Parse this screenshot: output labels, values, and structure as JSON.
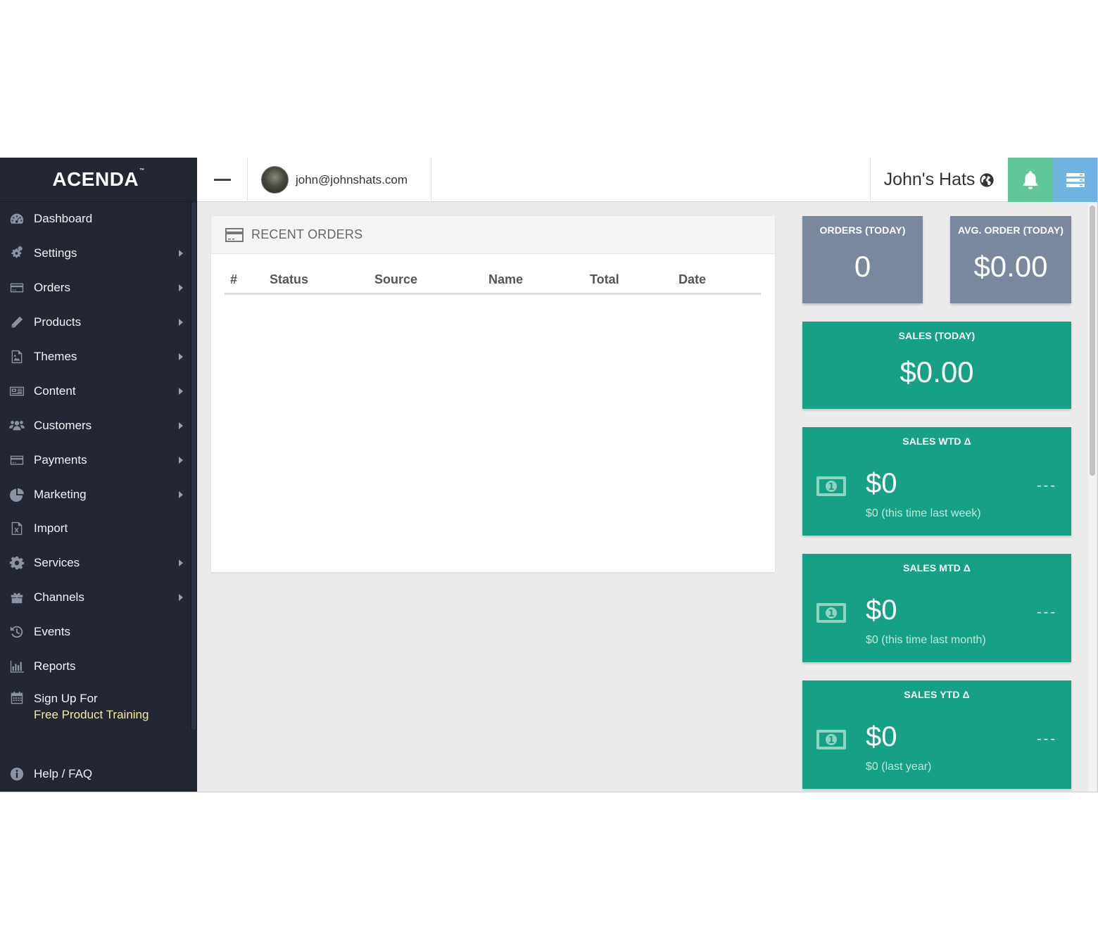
{
  "brand": {
    "logo": "ACENDA",
    "tm": "™"
  },
  "sidebar": {
    "items": [
      {
        "label": "Dashboard",
        "icon": "dashboard-icon",
        "chevron": false
      },
      {
        "label": "Settings",
        "icon": "gears-icon",
        "chevron": true
      },
      {
        "label": "Orders",
        "icon": "credit-card-icon",
        "chevron": true
      },
      {
        "label": "Products",
        "icon": "pencil-icon",
        "chevron": true
      },
      {
        "label": "Themes",
        "icon": "image-file-icon",
        "chevron": true
      },
      {
        "label": "Content",
        "icon": "newspaper-icon",
        "chevron": true
      },
      {
        "label": "Customers",
        "icon": "users-icon",
        "chevron": true
      },
      {
        "label": "Payments",
        "icon": "credit-card-icon",
        "chevron": true
      },
      {
        "label": "Marketing",
        "icon": "pie-chart-icon",
        "chevron": true
      },
      {
        "label": "Import",
        "icon": "excel-file-icon",
        "chevron": false
      },
      {
        "label": "Services",
        "icon": "gear-icon",
        "chevron": true
      },
      {
        "label": "Channels",
        "icon": "gift-icon",
        "chevron": true
      },
      {
        "label": "Events",
        "icon": "history-icon",
        "chevron": false
      },
      {
        "label": "Reports",
        "icon": "bar-chart-icon",
        "chevron": false
      }
    ],
    "training": {
      "line1": "Sign Up For",
      "line2": "Free Product Training",
      "icon": "calendar-icon"
    },
    "help": {
      "label": "Help / FAQ",
      "icon": "info-icon"
    }
  },
  "topbar": {
    "user_email": "john@johnshats.com",
    "store_name": "John's Hats",
    "colors": {
      "bell": "#5fc79a",
      "menu": "#6fb3e0"
    }
  },
  "recent_orders": {
    "title": "RECENT ORDERS",
    "columns": [
      "#",
      "Status",
      "Source",
      "Name",
      "Total",
      "Date"
    ],
    "rows": []
  },
  "stats": {
    "orders_today": {
      "title": "ORDERS (TODAY)",
      "value": "0"
    },
    "avg_order_today": {
      "title": "AVG. ORDER (TODAY)",
      "value": "$0.00"
    },
    "sales_today": {
      "title": "SALES (TODAY)",
      "value": "$0.00"
    },
    "sales_wtd": {
      "title": "SALES WTD Δ",
      "value": "$0",
      "compare": "$0 (this time last week)",
      "delta": "---"
    },
    "sales_mtd": {
      "title": "SALES MTD Δ",
      "value": "$0",
      "compare": "$0 (this time last month)",
      "delta": "---"
    },
    "sales_ytd": {
      "title": "SALES YTD Δ",
      "value": "$0",
      "compare": "$0 (last year)",
      "delta": "---"
    }
  },
  "colors": {
    "sidebar": "#232734",
    "card_gray": "#7a889e",
    "card_green": "#16a085"
  }
}
